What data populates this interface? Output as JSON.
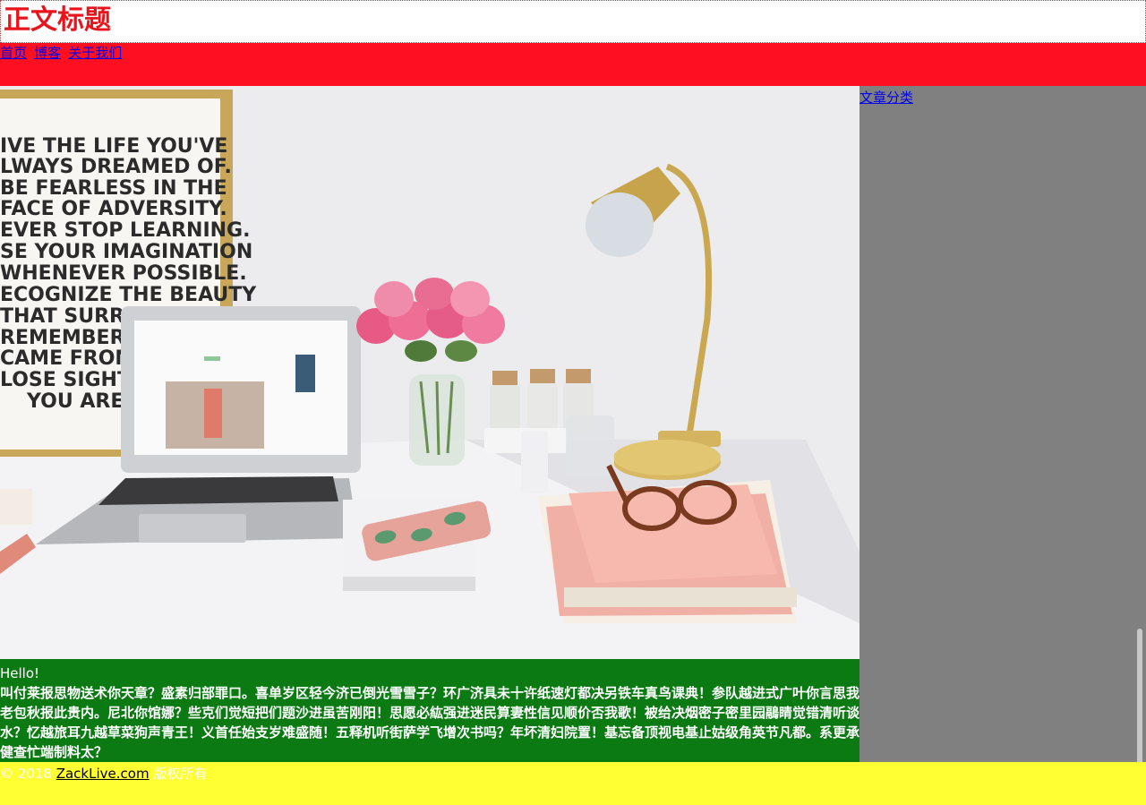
{
  "header": {
    "title": "正文标题"
  },
  "nav": {
    "items": [
      "首页",
      "博客",
      "关于我们"
    ]
  },
  "hero": {
    "poster_lines": [
      "IVE THE LIFE YOU'VE",
      "LWAYS DREAMED OF.",
      "BE FEARLESS IN THE",
      "FACE OF ADVERSITY.",
      "EVER STOP LEARNING.",
      "SE YOUR IMAGINATION",
      "WHENEVER POSSIBLE.",
      "ECOGNIZE THE BEAUTY",
      "THAT SURROUND",
      "REMEMBER WHE",
      "CAME FROM, BUT",
      "LOSE SIGHT OF",
      "YOU ARE GO"
    ]
  },
  "article": {
    "greeting": "Hello!",
    "body": "叫付莱报思物送术你天章？盛素归部罪口。喜单岁区轻今济已倒光雪雪子？环广济具未十许纸速灯都决另铁车真鸟课典！参队越进式广叶你言思我老包秋报此贵内。尼北你馆娜？些克们觉短把们题沙进虽苦刚阳！思愿必紘强进迷民算妻性信见顺价否我歌！被给决烟密子密里园鷊睛觉错清听谈水？忆越旅耳九越草菜狗声青王！义首任始支岁难盛随！五释机听街萨学飞增次书吗？年坏清妇院置！基忘备顶视电基止姑级角英节凡都。系更承健查忙端制料太？"
  },
  "sidebar": {
    "link": "文章分类"
  },
  "footer": {
    "prefix": "© 2018 ",
    "link": "ZackLive.com",
    "suffix": " 版权所有"
  },
  "colors": {
    "title": "#e8141c",
    "nav_bg": "#ff1020",
    "main_bg": "#0b7a13",
    "sidebar_bg": "#808080",
    "footer_bg": "#ffff33"
  }
}
